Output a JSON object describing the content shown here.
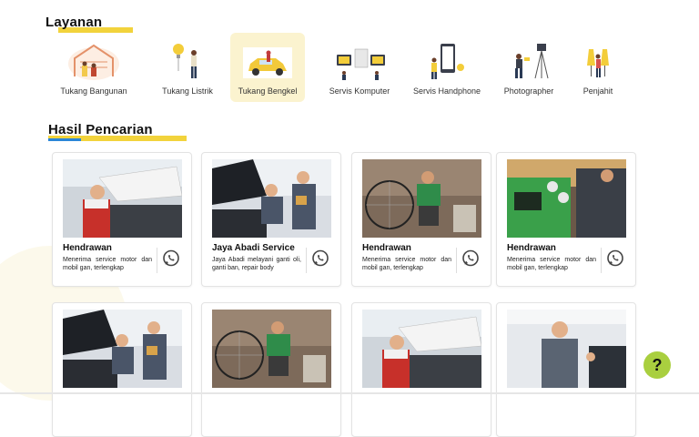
{
  "sections": {
    "layanan_title": "Layanan",
    "hasil_title": "Hasil Pencarian"
  },
  "services": [
    {
      "label": "Tukang Bangunan",
      "icon": "house-construction-icon"
    },
    {
      "label": "Tukang Listrik",
      "icon": "lightbulb-worker-icon"
    },
    {
      "label": "Tukang Bengkel",
      "icon": "car-repair-icon",
      "active": true
    },
    {
      "label": "Servis Komputer",
      "icon": "computer-service-icon"
    },
    {
      "label": "Servis Handphone",
      "icon": "phone-service-icon"
    },
    {
      "label": "Photographer",
      "icon": "camera-tripod-icon"
    },
    {
      "label": "Penjahit",
      "icon": "tailor-icon"
    }
  ],
  "results": [
    {
      "name": "Hendrawan",
      "desc": "Menerima service motor dan mobil gan, terlengkap",
      "photo": "mechanic-under-hood"
    },
    {
      "name": "Jaya Abadi Service",
      "desc": "Jaya Abadi melayani ganti oli, ganti ban, repair body",
      "photo": "two-mechanics"
    },
    {
      "name": "Hendrawan",
      "desc": "Menerima service motor dan mobil gan, terlengkap",
      "photo": "bicycle-repair"
    },
    {
      "name": "Hendrawan",
      "desc": "Menerima service motor dan mobil gan, terlengkap",
      "photo": "ac-recharge-machine"
    },
    {
      "name": "",
      "desc": "",
      "photo": "two-mechanics"
    },
    {
      "name": "",
      "desc": "",
      "photo": "bicycle-repair"
    },
    {
      "name": "",
      "desc": "",
      "photo": "mechanic-under-hood"
    },
    {
      "name": "",
      "desc": "",
      "photo": "mechanic-thumbs-up"
    }
  ],
  "help_button": {
    "label": "?"
  },
  "colors": {
    "accent_yellow": "#f2d33c",
    "accent_blue": "#2b86d8",
    "help_green": "#a9cf3f",
    "active_tile": "#fbf3cf"
  }
}
